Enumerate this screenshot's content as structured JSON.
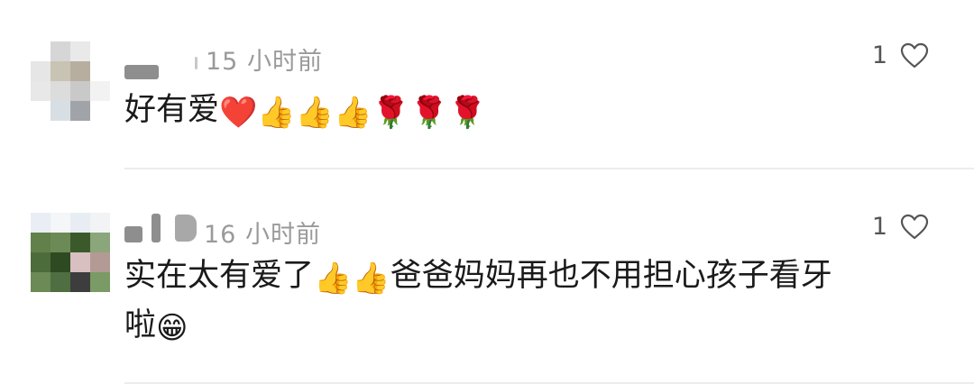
{
  "comments": [
    {
      "username": "",
      "time": "15 小时前",
      "like_count": "1",
      "text": "好有爱",
      "emojis": [
        "❤️",
        "👍",
        "👍",
        "👍",
        "🌹",
        "🌹",
        "🌹"
      ],
      "avatar_colors": [
        "#ffffff",
        "#d6d6d6",
        "#e9e9e9",
        "#ffffff",
        "#e6e6e6",
        "#c9c3b4",
        "#b8aea0",
        "#ffffff",
        "#e8e8e8",
        "#dcdcdc",
        "#c9c9c9",
        "#f2f2f2",
        "#ffffff",
        "#d8dfe4",
        "#a0a4a8",
        "#ffffff"
      ]
    },
    {
      "username": "",
      "time": "16 小时前",
      "like_count": "1",
      "text_line1": "实在太有爱了",
      "emojis_mid": [
        "👍",
        "👍"
      ],
      "text_line1_tail": "爸爸妈妈再也不用担心孩子看牙",
      "text_line2": "啦",
      "emoji_end": "😁",
      "avatar_colors": [
        "#e8eef4",
        "#f4f6f8",
        "#e7edf3",
        "#f1f3f5",
        "#61804a",
        "#6c8a55",
        "#3b5a2c",
        "#8ba67a",
        "#4d6c3b",
        "#2e4a22",
        "#d8c0c0",
        "#b49a94",
        "#6c8a55",
        "#4f6e41",
        "#3d3d3d",
        "#7a9a66"
      ]
    }
  ]
}
